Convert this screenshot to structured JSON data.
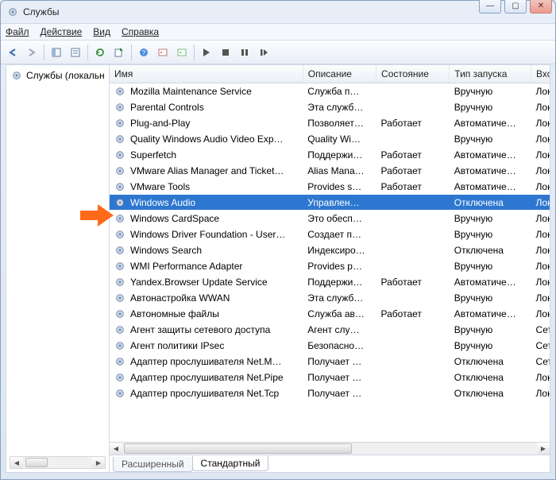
{
  "window": {
    "title": "Службы"
  },
  "menu": {
    "file": "Файл",
    "action": "Действие",
    "view": "Вид",
    "help": "Справка"
  },
  "winbuttons": {
    "min": "—",
    "max": "▢",
    "close": "✕"
  },
  "toolbar_icons": {
    "back": "back-arrow-icon",
    "forward": "forward-arrow-icon",
    "up": "hide-pane-icon",
    "props": "properties-icon",
    "refresh": "refresh-icon",
    "export": "export-icon",
    "help": "help-icon",
    "play": "start-icon",
    "stop": "stop-icon",
    "pause": "pause-icon",
    "restart": "restart-icon",
    "i1": "i1",
    "i2": "i2"
  },
  "tree": {
    "root": "Службы (локальн"
  },
  "columns": {
    "name": "Имя",
    "desc": "Описание",
    "state": "Состояние",
    "startup": "Тип запуска",
    "logon": "Вхо"
  },
  "tabs": {
    "extended": "Расширенный",
    "standard": "Стандартный"
  },
  "selected_index": 7,
  "services": [
    {
      "name": "Mozilla Maintenance Service",
      "desc": "Служба п…",
      "state": "",
      "startup": "Вручную",
      "logon": "Лока"
    },
    {
      "name": "Parental Controls",
      "desc": "Эта служб…",
      "state": "",
      "startup": "Вручную",
      "logon": "Лока"
    },
    {
      "name": "Plug-and-Play",
      "desc": "Позволяет…",
      "state": "Работает",
      "startup": "Автоматиче…",
      "logon": "Лока"
    },
    {
      "name": "Quality Windows Audio Video Exp…",
      "desc": "Quality Wi…",
      "state": "",
      "startup": "Вручную",
      "logon": "Лока"
    },
    {
      "name": "Superfetch",
      "desc": "Поддержи…",
      "state": "Работает",
      "startup": "Автоматиче…",
      "logon": "Лока"
    },
    {
      "name": "VMware Alias Manager and Ticket…",
      "desc": "Alias Mana…",
      "state": "Работает",
      "startup": "Автоматиче…",
      "logon": "Лока"
    },
    {
      "name": "VMware Tools",
      "desc": "Provides s…",
      "state": "Работает",
      "startup": "Автоматиче…",
      "logon": "Лока"
    },
    {
      "name": "Windows Audio",
      "desc": "Управлен…",
      "state": "",
      "startup": "Отключена",
      "logon": "Лока"
    },
    {
      "name": "Windows CardSpace",
      "desc": "Это обесп…",
      "state": "",
      "startup": "Вручную",
      "logon": "Лока"
    },
    {
      "name": "Windows Driver Foundation - User…",
      "desc": "Создает п…",
      "state": "",
      "startup": "Вручную",
      "logon": "Лока"
    },
    {
      "name": "Windows Search",
      "desc": "Индексиро…",
      "state": "",
      "startup": "Отключена",
      "logon": "Лока"
    },
    {
      "name": "WMI Performance Adapter",
      "desc": "Provides p…",
      "state": "",
      "startup": "Вручную",
      "logon": "Лока"
    },
    {
      "name": "Yandex.Browser Update Service",
      "desc": "Поддержи…",
      "state": "Работает",
      "startup": "Автоматиче…",
      "logon": "Лока"
    },
    {
      "name": "Автонастройка WWAN",
      "desc": "Эта служб…",
      "state": "",
      "startup": "Вручную",
      "logon": "Лока"
    },
    {
      "name": "Автономные файлы",
      "desc": "Служба ав…",
      "state": "Работает",
      "startup": "Автоматиче…",
      "logon": "Лока"
    },
    {
      "name": "Агент защиты сетевого доступа",
      "desc": "Агент слу…",
      "state": "",
      "startup": "Вручную",
      "logon": "Сете"
    },
    {
      "name": "Агент политики IPsec",
      "desc": "Безопасно…",
      "state": "",
      "startup": "Вручную",
      "logon": "Сете"
    },
    {
      "name": "Адаптер прослушивателя Net.M…",
      "desc": "Получает …",
      "state": "",
      "startup": "Отключена",
      "logon": "Сете"
    },
    {
      "name": "Адаптер прослушивателя Net.Pipe",
      "desc": "Получает …",
      "state": "",
      "startup": "Отключена",
      "logon": "Лока"
    },
    {
      "name": "Адаптер прослушивателя Net.Tcp",
      "desc": "Получает …",
      "state": "",
      "startup": "Отключена",
      "logon": "Лока"
    }
  ]
}
